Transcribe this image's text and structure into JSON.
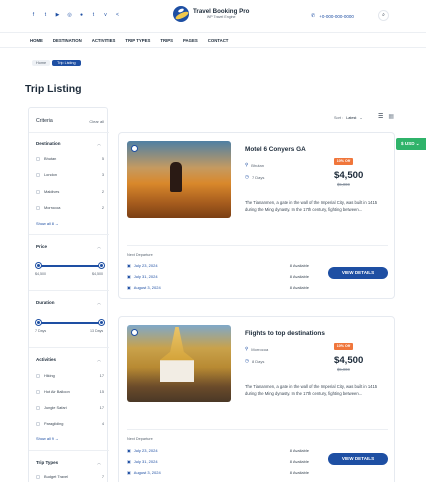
{
  "header": {
    "social_icons": [
      "facebook-icon",
      "twitter-icon",
      "youtube-icon",
      "instagram-icon",
      "flickr-icon",
      "tumblr-icon",
      "vk-icon",
      "share-icon"
    ],
    "logo_title": "Travel Booking Pro",
    "logo_subtitle": "WP Travel Engine",
    "phone": "+0-000-000-0000",
    "brand_color": "#1e4fa3"
  },
  "nav": {
    "items": [
      "HOME",
      "DESTINATION",
      "ACTIVITIES",
      "TRIP TYPES",
      "TRIPS",
      "PAGES",
      "CONTACT"
    ]
  },
  "breadcrumb": {
    "home": "Home",
    "current": "Trip Listing"
  },
  "page_title": "Trip Listing",
  "filters": {
    "header": "Criteria",
    "clear": "Clear all",
    "destination": {
      "title": "Destination",
      "items": [
        {
          "label": "Bhutan",
          "count": "5"
        },
        {
          "label": "London",
          "count": "3"
        },
        {
          "label": "Maldives",
          "count": "2"
        },
        {
          "label": "Morrocoa",
          "count": "2"
        }
      ],
      "show_all": "Show all 8"
    },
    "price": {
      "title": "Price",
      "min": "$4,500",
      "max": "$4,500"
    },
    "duration": {
      "title": "Duration",
      "min": "7 Days",
      "max": "13 Days"
    },
    "activities": {
      "title": "Activities",
      "items": [
        {
          "label": "Hiking",
          "count": "17"
        },
        {
          "label": "Hot Air Balloon",
          "count": "15"
        },
        {
          "label": "Jungle Safari",
          "count": "17"
        },
        {
          "label": "Paragliding",
          "count": "4"
        }
      ],
      "show_all": "Show all 9"
    },
    "trip_types": {
      "title": "Trip Types",
      "items": [
        {
          "label": "Budget Travel",
          "count": "7"
        }
      ]
    }
  },
  "sort": {
    "label": "Sort :",
    "value": "Latest"
  },
  "currency": "$ USD",
  "trips": [
    {
      "title": "Motel 6 Conyers GA",
      "location": "Bhutan",
      "duration": "7 Days",
      "discount": "10% Off",
      "price": "$4,500",
      "old_price": "$5,000",
      "description": "The Tiananmen, a gate in the wall of the Imperial City, was built in 1415 during the Ming dynasty. In the 17th century, fighting between...",
      "next_departure_label": "Next Departure",
      "departures": [
        {
          "date": "July 23, 2024",
          "availability": "8 Available"
        },
        {
          "date": "July 31, 2024",
          "availability": "8 Available"
        },
        {
          "date": "August 3, 2024",
          "availability": "8 Available"
        }
      ],
      "button": "VIEW DETAILS"
    },
    {
      "title": "Flights to top destinations",
      "location": "Morrocoa",
      "duration": "8 Days",
      "discount": "10% Off",
      "price": "$4,500",
      "old_price": "$5,000",
      "description": "The Tiananmen, a gate in the wall of the Imperial City, was built in 1415 during the Ming dynasty. In the 17th century, fighting between...",
      "next_departure_label": "Next Departure",
      "departures": [
        {
          "date": "July 23, 2024",
          "availability": "8 Available"
        },
        {
          "date": "July 31, 2024",
          "availability": "8 Available"
        },
        {
          "date": "August 3, 2024",
          "availability": "8 Available"
        }
      ],
      "button": "VIEW DETAILS"
    }
  ]
}
